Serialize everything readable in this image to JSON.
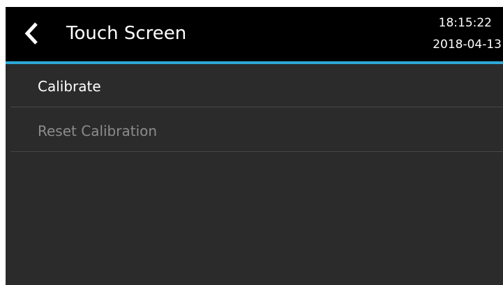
{
  "header": {
    "title": "Touch Screen",
    "back_icon": "chevron-left-icon",
    "time": "18:15:22",
    "date": "2018-04-13"
  },
  "menu": {
    "items": [
      {
        "label": "Calibrate",
        "enabled": true
      },
      {
        "label": "Reset Calibration",
        "enabled": false
      }
    ]
  },
  "colors": {
    "header_bg": "#000000",
    "body_bg": "#2b2b2b",
    "accent": "#2da9d8",
    "text": "#ffffff",
    "text_disabled": "#8c8c8c",
    "divider": "#474747"
  }
}
